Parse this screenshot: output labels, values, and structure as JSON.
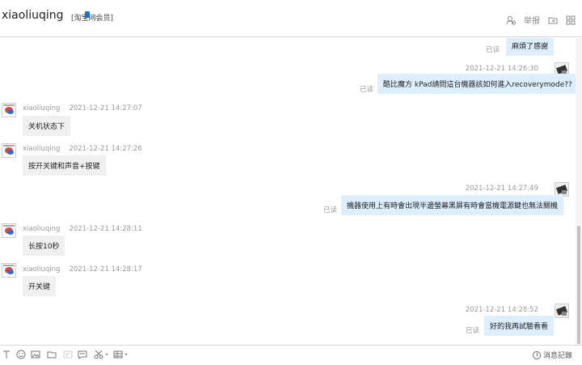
{
  "header": {
    "contact_name": "xiaoliuqing",
    "member_badge": "[淘宝网会员]",
    "report_label": "举报"
  },
  "messages": [
    {
      "side": "right",
      "text": "麻煩了感謝",
      "read": "已读"
    },
    {
      "side": "right",
      "time": "2021-12-21 14:26:30",
      "text": "酷比魔方 kPad請問這台機器該如何進入recoverymode??",
      "read": "已读"
    },
    {
      "side": "left",
      "sender": "xiaoliuqing",
      "time": "2021-12-21 14:27:07",
      "text": "关机状态下"
    },
    {
      "side": "left",
      "sender": "xiaoliuqing",
      "time": "2021-12-21 14:27:26",
      "text": "按开关键和声音+按键"
    },
    {
      "side": "right",
      "time": "2021-12-21 14:27:49",
      "text": "機器使用上有時會出現半邊螢幕黑屏有時會當機電源鍵也無法關機",
      "read": "已读"
    },
    {
      "side": "left",
      "sender": "xiaoliuqing",
      "time": "2021-12-21 14:28:11",
      "text": "长按10秒"
    },
    {
      "side": "left",
      "sender": "xiaoliuqing",
      "time": "2021-12-21 14:28:17",
      "text": "开关键"
    },
    {
      "side": "right",
      "time": "2021-12-21 14:28:52",
      "text": "好的我再試驗看看",
      "read": "已读"
    }
  ],
  "toolbar": {
    "history_label": "消息記錄"
  }
}
